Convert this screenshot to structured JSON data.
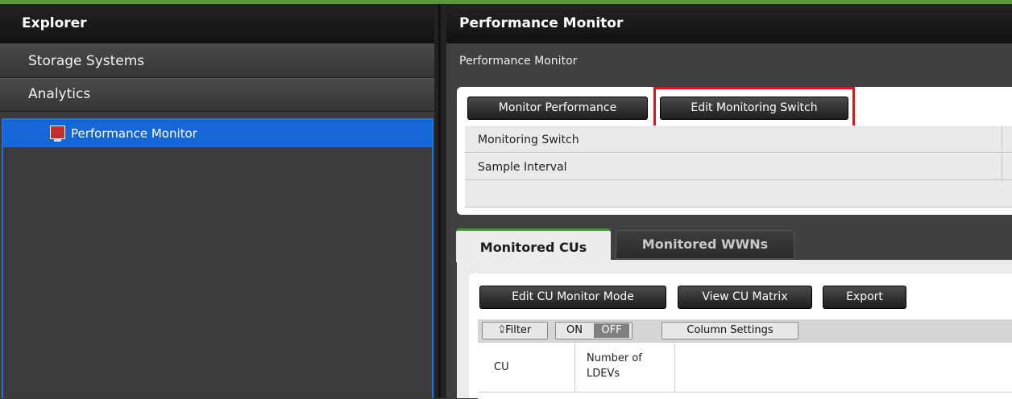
{
  "explorer": {
    "title": "Explorer",
    "items": [
      {
        "label": "Storage Systems"
      },
      {
        "label": "Analytics"
      }
    ],
    "tree": {
      "selected_label": "Performance Monitor"
    }
  },
  "main": {
    "title": "Performance Monitor",
    "breadcrumb": "Performance Monitor",
    "panel": {
      "buttons": {
        "monitor_performance": "Monitor Performance",
        "edit_monitoring_switch": "Edit Monitoring Switch"
      },
      "properties": [
        {
          "label": "Monitoring Switch"
        },
        {
          "label": "Sample Interval"
        }
      ]
    },
    "tabs": {
      "active": "Monitored CUs",
      "inactive": "Monitored WWNs"
    },
    "toolbar": {
      "edit_cu_monitor_mode": "Edit CU Monitor Mode",
      "view_cu_matrix": "View CU Matrix",
      "export": "Export"
    },
    "filter": {
      "filter_label": "⮸Filter",
      "on_label": "ON",
      "off_label": "OFF",
      "column_settings": "Column Settings"
    },
    "table": {
      "columns": [
        "CU",
        "Number of LDEVs"
      ]
    }
  },
  "colors": {
    "accent_green": "#3f9a2f",
    "selection_blue": "#1566d6",
    "highlight_red": "#e0151b"
  }
}
